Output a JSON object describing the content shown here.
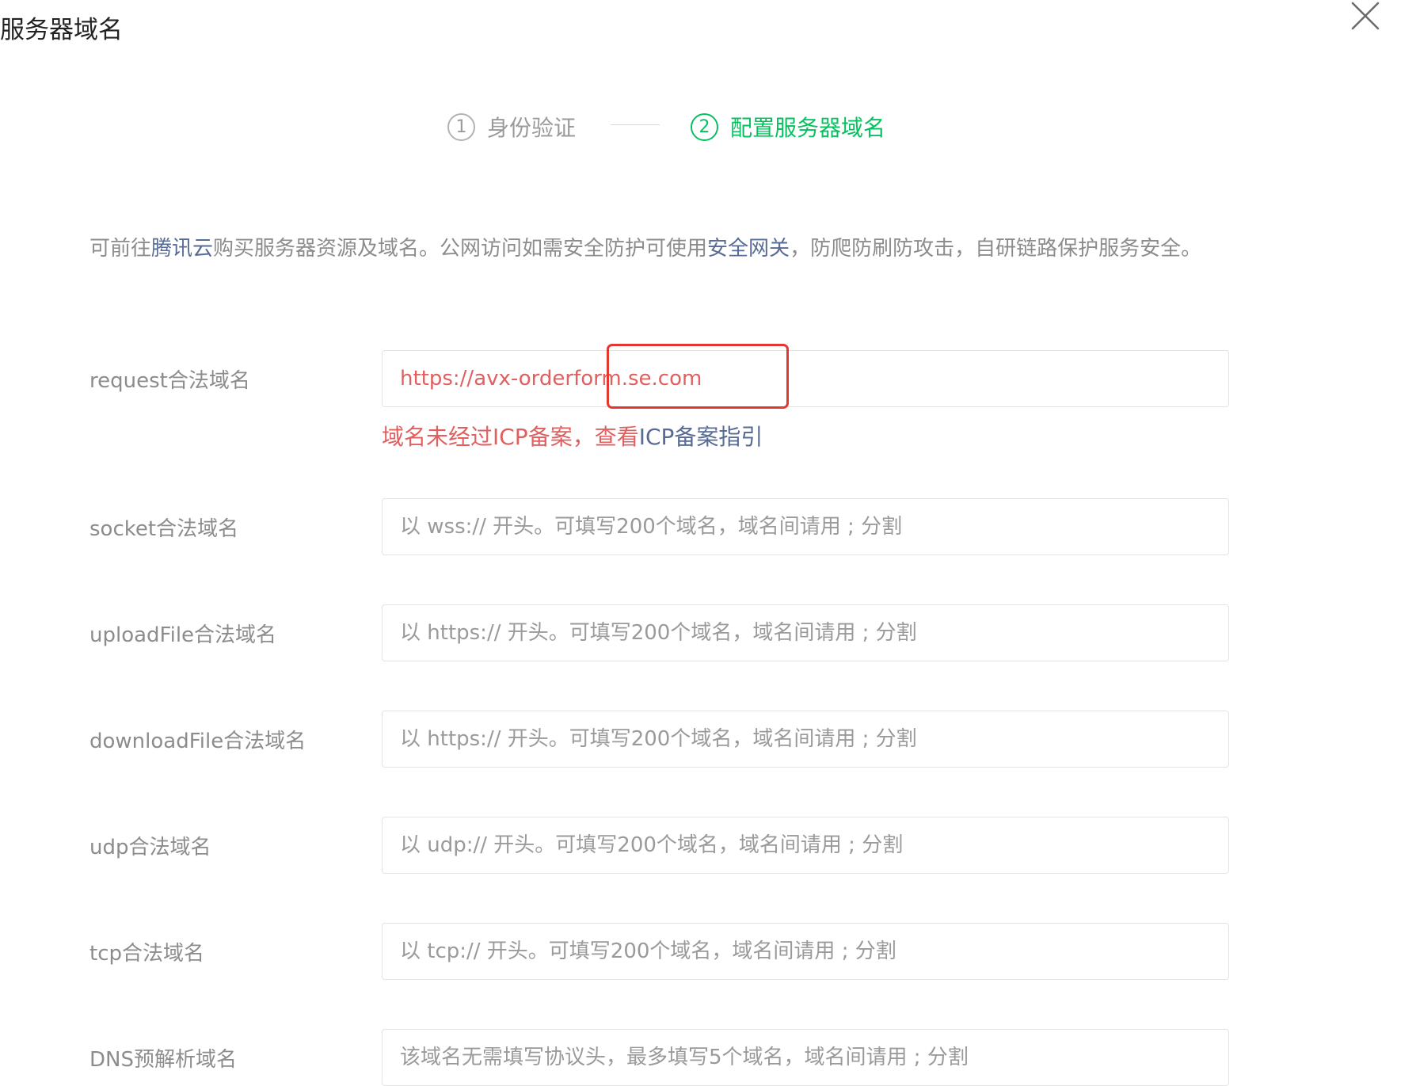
{
  "dialog": {
    "title": "服务器域名",
    "close_icon": "close-icon"
  },
  "stepper": {
    "steps": [
      {
        "number": "1",
        "label": "身份验证",
        "active": false
      },
      {
        "number": "2",
        "label": "配置服务器域名",
        "active": true
      }
    ],
    "active_color": "#07c160",
    "inactive_color": "#9a9a9a"
  },
  "intro": {
    "prefix": "可前往",
    "link1": "腾讯云",
    "middle": "购买服务器资源及域名。公网访问如需安全防护可使用",
    "link2": "安全网关",
    "suffix": "，防爬防刷防攻击，自研链路保护服务安全。",
    "link_color": "#576b95"
  },
  "form": {
    "request": {
      "label": "request合法域名",
      "value": "https://avx-orderform.se.com",
      "error_text": "域名未经过ICP备案，查看",
      "error_link": "ICP备案指引",
      "error_color": "#e15f5f"
    },
    "socket": {
      "label": "socket合法域名",
      "placeholder": "以 wss:// 开头。可填写200个域名，域名间请用 ; 分割"
    },
    "uploadFile": {
      "label": "uploadFile合法域名",
      "placeholder": "以 https:// 开头。可填写200个域名，域名间请用 ; 分割"
    },
    "downloadFile": {
      "label": "downloadFile合法域名",
      "placeholder": "以 https:// 开头。可填写200个域名，域名间请用 ; 分割"
    },
    "udp": {
      "label": "udp合法域名",
      "placeholder": "以 udp:// 开头。可填写200个域名，域名间请用 ; 分割"
    },
    "tcp": {
      "label": "tcp合法域名",
      "placeholder": "以 tcp:// 开头。可填写200个域名，域名间请用 ; 分割"
    },
    "dns": {
      "label": "DNS预解析域名",
      "placeholder": "该域名无需填写协议头，最多填写5个域名，域名间请用 ; 分割"
    }
  },
  "annotation": {
    "highlight_color": "#e3382f"
  }
}
